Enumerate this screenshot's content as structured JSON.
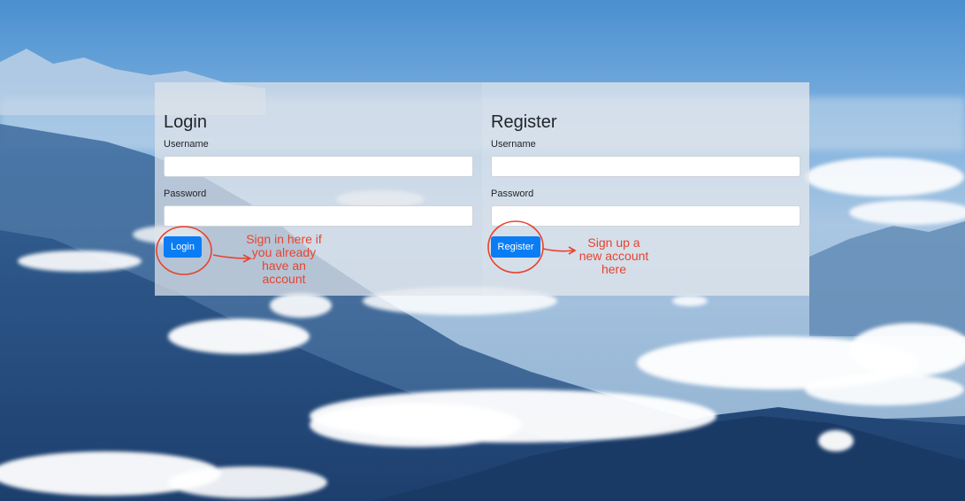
{
  "login": {
    "title": "Login",
    "username_label": "Username",
    "username_value": "",
    "password_label": "Password",
    "password_value": "",
    "button_label": "Login"
  },
  "register": {
    "title": "Register",
    "username_label": "Username",
    "username_value": "",
    "password_label": "Password",
    "password_value": "",
    "button_label": "Register"
  },
  "annotations": {
    "login_note_lines": [
      "Sign in here if",
      "you already",
      "have an",
      "account"
    ],
    "register_note_lines": [
      "Sign up a",
      "new account",
      "here"
    ]
  },
  "colors": {
    "accent": "#0a7df5",
    "annotation": "#e8432e"
  }
}
